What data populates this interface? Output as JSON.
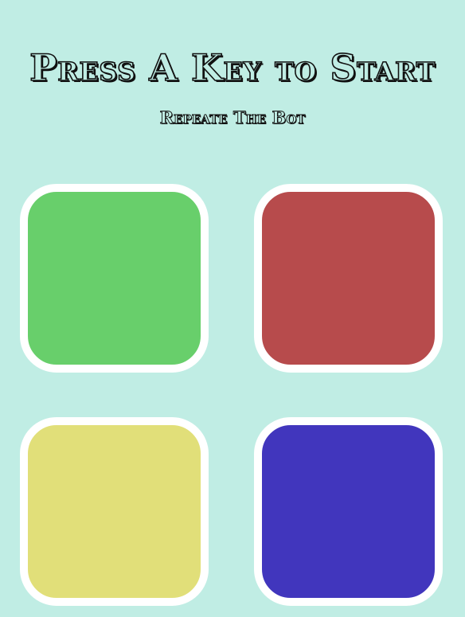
{
  "header": {
    "title": "Press A Key to Start",
    "subtitle": "Repeate The Bot"
  },
  "colors": {
    "background": "#c0ede4",
    "border": "#ffffff",
    "green": "#68cf6b",
    "red": "#b74b4c",
    "yellow": "#e1df79",
    "blue": "#4136bd"
  },
  "buttons": [
    {
      "id": "green"
    },
    {
      "id": "red"
    },
    {
      "id": "yellow"
    },
    {
      "id": "blue"
    }
  ]
}
